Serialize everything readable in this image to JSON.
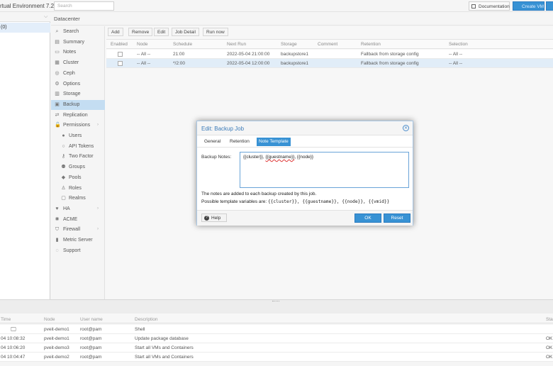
{
  "header": {
    "title": "rtual Environment 7.2-3",
    "search_placeholder": "Search",
    "documentation_label": "Documentation",
    "create_vm_label": "Create VM"
  },
  "tree": {
    "node_label": "(0)"
  },
  "datacenter": {
    "title": "Datacenter"
  },
  "nav": {
    "items": [
      {
        "label": "Search",
        "icon": "search-icon"
      },
      {
        "label": "Summary",
        "icon": "book-icon"
      },
      {
        "label": "Notes",
        "icon": "notes-icon"
      },
      {
        "label": "Cluster",
        "icon": "server-icon"
      },
      {
        "label": "Ceph",
        "icon": "ceph-icon"
      },
      {
        "label": "Options",
        "icon": "gear-icon"
      },
      {
        "label": "Storage",
        "icon": "database-icon"
      },
      {
        "label": "Backup",
        "icon": "floppy-icon"
      },
      {
        "label": "Replication",
        "icon": "retweet-icon"
      },
      {
        "label": "Permissions",
        "icon": "unlock-icon"
      },
      {
        "label": "Users",
        "icon": "user-icon"
      },
      {
        "label": "API Tokens",
        "icon": "user-o-icon"
      },
      {
        "label": "Two Factor",
        "icon": "key-icon"
      },
      {
        "label": "Groups",
        "icon": "users-icon"
      },
      {
        "label": "Pools",
        "icon": "tags-icon"
      },
      {
        "label": "Roles",
        "icon": "male-icon"
      },
      {
        "label": "Realms",
        "icon": "address-book-icon"
      },
      {
        "label": "HA",
        "icon": "heartbeat-icon"
      },
      {
        "label": "ACME",
        "icon": "certificate-icon"
      },
      {
        "label": "Firewall",
        "icon": "shield-icon"
      },
      {
        "label": "Metric Server",
        "icon": "bar-chart-icon"
      },
      {
        "label": "Support",
        "icon": "comments-icon"
      }
    ]
  },
  "toolbar": {
    "add": "Add",
    "remove": "Remove",
    "edit": "Edit",
    "job_detail": "Job Detail",
    "run_now": "Run now"
  },
  "grid": {
    "columns": [
      "Enabled",
      "Node",
      "Schedule",
      "Next Run",
      "Storage",
      "Comment",
      "Retention",
      "Selection"
    ],
    "rows": [
      {
        "node": "-- All --",
        "schedule": "21:00",
        "next_run": "2022-05-04 21:00:00",
        "storage": "backupstore1",
        "comment": "",
        "retention": "Fallback from storage config",
        "selection": "-- All --"
      },
      {
        "node": "-- All --",
        "schedule": "*/2:00",
        "next_run": "2022-05-04 12:00:00",
        "storage": "backupstore1",
        "comment": "",
        "retention": "Fallback from storage config",
        "selection": "-- All --"
      }
    ]
  },
  "log": {
    "columns": [
      "Time",
      "Node",
      "User name",
      "Description",
      "Sta"
    ],
    "rows": [
      {
        "time": "",
        "node": "pveit-demo1",
        "user": "root@pam",
        "desc": "Shell",
        "status": ""
      },
      {
        "time": "04 10:08:32",
        "node": "pveit-demo1",
        "user": "root@pam",
        "desc": "Update package database",
        "status": "OK"
      },
      {
        "time": "04 10:06:20",
        "node": "pveit-demo3",
        "user": "root@pam",
        "desc": "Start all VMs and Containers",
        "status": "OK"
      },
      {
        "time": "04 10:04:47",
        "node": "pveit-demo2",
        "user": "root@pam",
        "desc": "Start all VMs and Containers",
        "status": "OK"
      }
    ]
  },
  "dialog": {
    "title": "Edit: Backup Job",
    "tabs": [
      "General",
      "Retention",
      "Note Template"
    ],
    "notes_label": "Backup Notes:",
    "notes_value_1": "{{cluster}}, ",
    "notes_value_2": "{{guestname}}",
    "notes_value_3": ", {{node}}",
    "info_line_1": "The notes are added to each backup created by this job.",
    "info_line_2_prefix": "Possible template variables are: ",
    "info_line_2_vars": "{{cluster}}, {{guestname}}, {{node}}, {{vmid}}",
    "help_label": "Help",
    "ok_label": "OK",
    "reset_label": "Reset"
  },
  "colors": {
    "accent": "#3892d4",
    "selected_nav": "#c4ddf2",
    "selected_row": "#e1edf8"
  }
}
